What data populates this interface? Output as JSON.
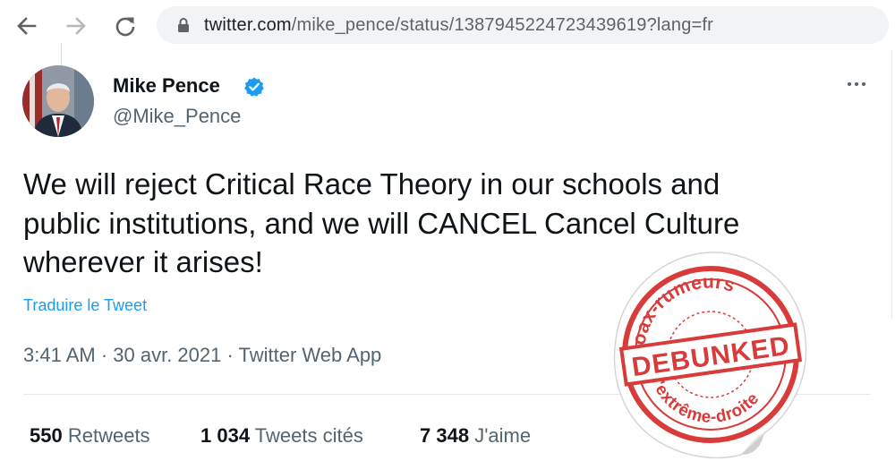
{
  "browser": {
    "url_host": "twitter.com",
    "url_rest": "/mike_pence/status/1387945224723439619?lang=fr",
    "icons": {
      "back": "arrow-left-icon",
      "forward": "arrow-right-icon",
      "reload": "reload-icon",
      "lock": "lock-icon"
    }
  },
  "tweet": {
    "author_name": "Mike Pence",
    "author_handle": "@Mike_Pence",
    "text_line1": "We will reject Critical Race Theory in our schools and",
    "text_line2": "public institutions, and we will CANCEL Cancel Culture",
    "text_line3": "wherever it arises!",
    "translate_label": "Traduire le Tweet",
    "meta": "3:41 AM · 30 avr. 2021 · Twitter Web App",
    "stats": [
      {
        "count": "550",
        "label": "Retweets"
      },
      {
        "count": "1 034",
        "label": "Tweets cités"
      },
      {
        "count": "7 348",
        "label": "J'aime"
      }
    ]
  },
  "stamp": {
    "top_text": "Hoax-rumeurs",
    "center_text": "DEBUNKED",
    "bottom_text": "d'extrême-droite",
    "color": "#d93a3a"
  },
  "colors": {
    "link": "#1d9bf0",
    "secondary_text": "#536471",
    "primary_text": "#0f1419"
  }
}
